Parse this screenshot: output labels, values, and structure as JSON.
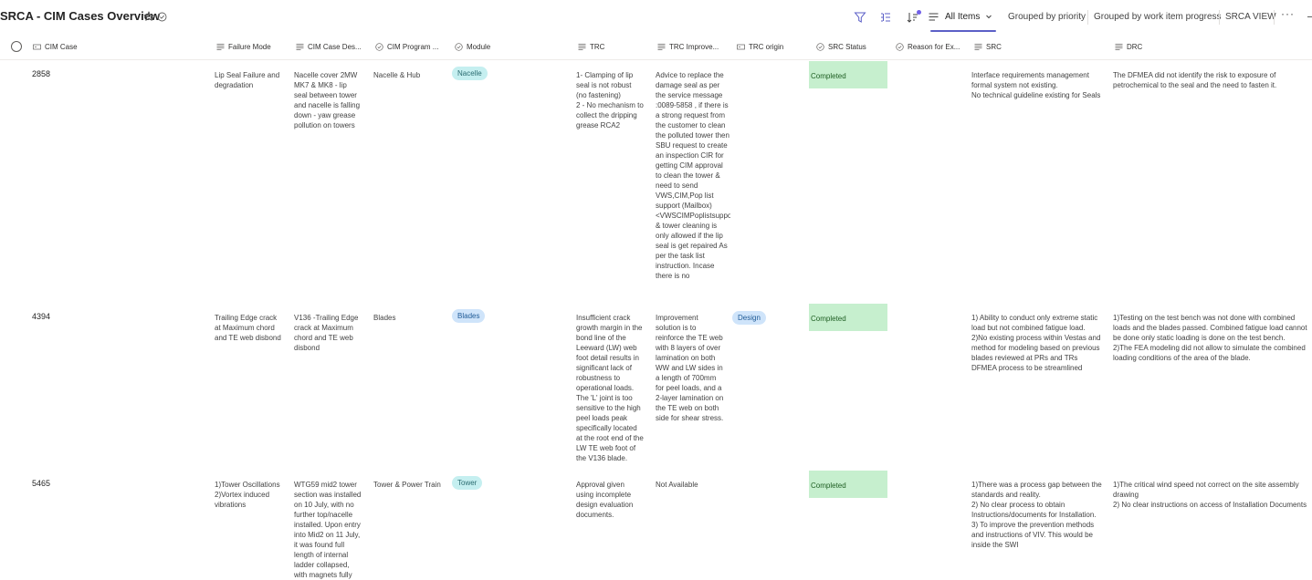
{
  "header": {
    "title": "SRCA - CIM Cases Overview",
    "view_label": "All Items",
    "tabs": [
      "Grouped by priority",
      "Grouped by work item progress",
      "SRCA VIEW"
    ],
    "more_label": "···"
  },
  "columns": [
    {
      "label": "CIM Case",
      "icon": "text-field-icon"
    },
    {
      "label": "Failure Mode",
      "icon": "multiline-text-icon"
    },
    {
      "label": "CIM Case Des...",
      "icon": "multiline-text-icon"
    },
    {
      "label": "CIM Program ...",
      "icon": "choice-icon"
    },
    {
      "label": "Module",
      "icon": "choice-icon"
    },
    {
      "label": "TRC",
      "icon": "multiline-text-icon"
    },
    {
      "label": "TRC Improve...",
      "icon": "multiline-text-icon"
    },
    {
      "label": "TRC origin",
      "icon": "text-field-icon"
    },
    {
      "label": "SRC Status",
      "icon": "choice-icon"
    },
    {
      "label": "Reason for Ex...",
      "icon": "choice-icon"
    },
    {
      "label": "SRC",
      "icon": "multiline-text-icon"
    },
    {
      "label": "DRC",
      "icon": "multiline-text-icon"
    }
  ],
  "rows": [
    {
      "cim_case": "2858",
      "failure_mode": "Lip Seal Failure and degradation",
      "description": "Nacelle cover 2MW MK7 & MK8 - lip seal between tower and nacelle is falling down - yaw grease pollution on towers",
      "program": "Nacelle & Hub",
      "module": "Nacelle",
      "trc": "1- Clamping of lip seal is not robust (no fastening)\n2 - No mechanism to collect the dripping grease RCA2",
      "trc_improvement": "Advice to replace the damage seal as per the service message :0089-5858 , if there is a strong request from the customer to clean the polluted tower then SBU request to create an inspection CIR for getting CIM approval to clean the tower & need to send VWS,CIM,Pop list support (Mailbox) <VWSCIMPoplistsupport & tower cleaning is only allowed if the lip seal is get repaired As per the task list instruction. Incase there is no",
      "trc_origin": "",
      "src_status": "Completed",
      "reason": "",
      "src": "Interface requirements management formal system not existing.\nNo technical guideline existing for Seals",
      "drc": "The DFMEA did not identify the risk to exposure of petrochemical to the seal and the need to fasten it."
    },
    {
      "cim_case": "4394",
      "failure_mode": "Trailing Edge crack at Maximum chord and TE web disbond",
      "description": "V136 -Trailing Edge crack at Maximum chord and TE web disbond",
      "program": "Blades",
      "module": "Blades",
      "trc": "Insufficient crack growth margin in the bond line of the Leeward (LW) web foot detail results in significant lack of robustness to operational loads. The 'L' joint is too sensitive to the high peel loads peak specifically located at the root end of the LW TE web foot of the V136 blade.",
      "trc_improvement": "Improvement solution is to reinforce the TE web with 8 layers of over lamination on both WW and LW sides in a length of 700mm for peel loads, and a 2-layer lamination on the TE web on both side for shear stress.",
      "trc_origin": "Design",
      "src_status": "Completed",
      "reason": "",
      "src": "1) Ability to conduct only extreme static load but not combined fatigue load.\n2)No existing process within Vestas and method for modeling based on previous blades reviewed at PRs and TRs DFMEA process to be streamlined",
      "drc": "1)Testing on the test bench was not done with combined loads and the blades passed. Combined fatigue load cannot be done only static loading is done on the test bench.\n2)The FEA modeling did not allow to simulate the combined loading conditions of the area of the blade."
    },
    {
      "cim_case": "5465",
      "failure_mode": "1)Tower Oscillations 2)Vortex induced vibrations",
      "description": "WTG59 mid2 tower section was installed on 10 July, with no further top/nacelle installed. Upon entry into Mid2 on 11 July, it was found full length of internal ladder collapsed, with magnets fully",
      "program": "Tower & Power Train",
      "module": "Tower",
      "trc": "Approval given using incomplete design evaluation documents.",
      "trc_improvement": "Not Available",
      "trc_origin": "",
      "src_status": "Completed",
      "reason": "",
      "src": "1)There was a process gap between the standards and reality.\n2) No clear process to obtain Instructions/documents for Installation.\n3) To improve the prevention methods and instructions of VIV. This would be inside the SWI",
      "drc": "1)The critical wind speed not correct on the site assembly drawing\n2) No clear instructions on access of Installation Documents"
    }
  ],
  "colors": {
    "status_completed_bg": "#c6efce",
    "pill_nacelle_bg": "#c5eff0",
    "pill_blades_bg": "#cfe4fa",
    "accent": "#5b5fc7"
  }
}
